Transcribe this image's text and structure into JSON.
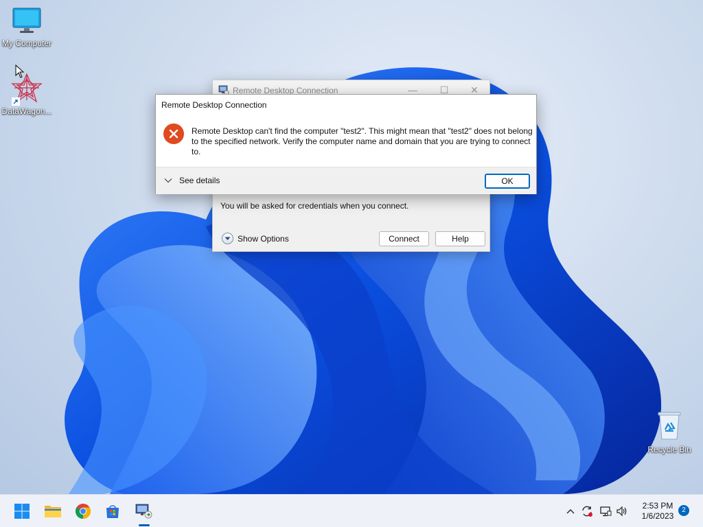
{
  "desktop": {
    "icons": [
      {
        "label": "My Computer"
      },
      {
        "label": "DataWagon..."
      },
      {
        "label": "Recycle Bin"
      }
    ]
  },
  "rdc_window": {
    "title": "Remote Desktop Connection",
    "credentials_note": "You will be asked for credentials when you connect.",
    "show_options_label": "Show Options",
    "connect_label": "Connect",
    "help_label": "Help"
  },
  "error_dialog": {
    "title": "Remote Desktop Connection",
    "message": "Remote Desktop can't find the computer \"test2\". This might mean that \"test2\" does not belong to the specified network.  Verify the computer name and domain that you are trying to connect to.",
    "see_details_label": "See details",
    "ok_label": "OK",
    "icon": "error-x-icon",
    "accent_color": "#e04a1f"
  },
  "taskbar": {
    "apps": [
      "windows-start-icon",
      "file-explorer-icon",
      "chrome-icon",
      "microsoft-store-icon",
      "remote-desktop-icon"
    ],
    "clock_time": "2:53 PM",
    "clock_date": "1/6/2023",
    "notification_count": "2"
  }
}
